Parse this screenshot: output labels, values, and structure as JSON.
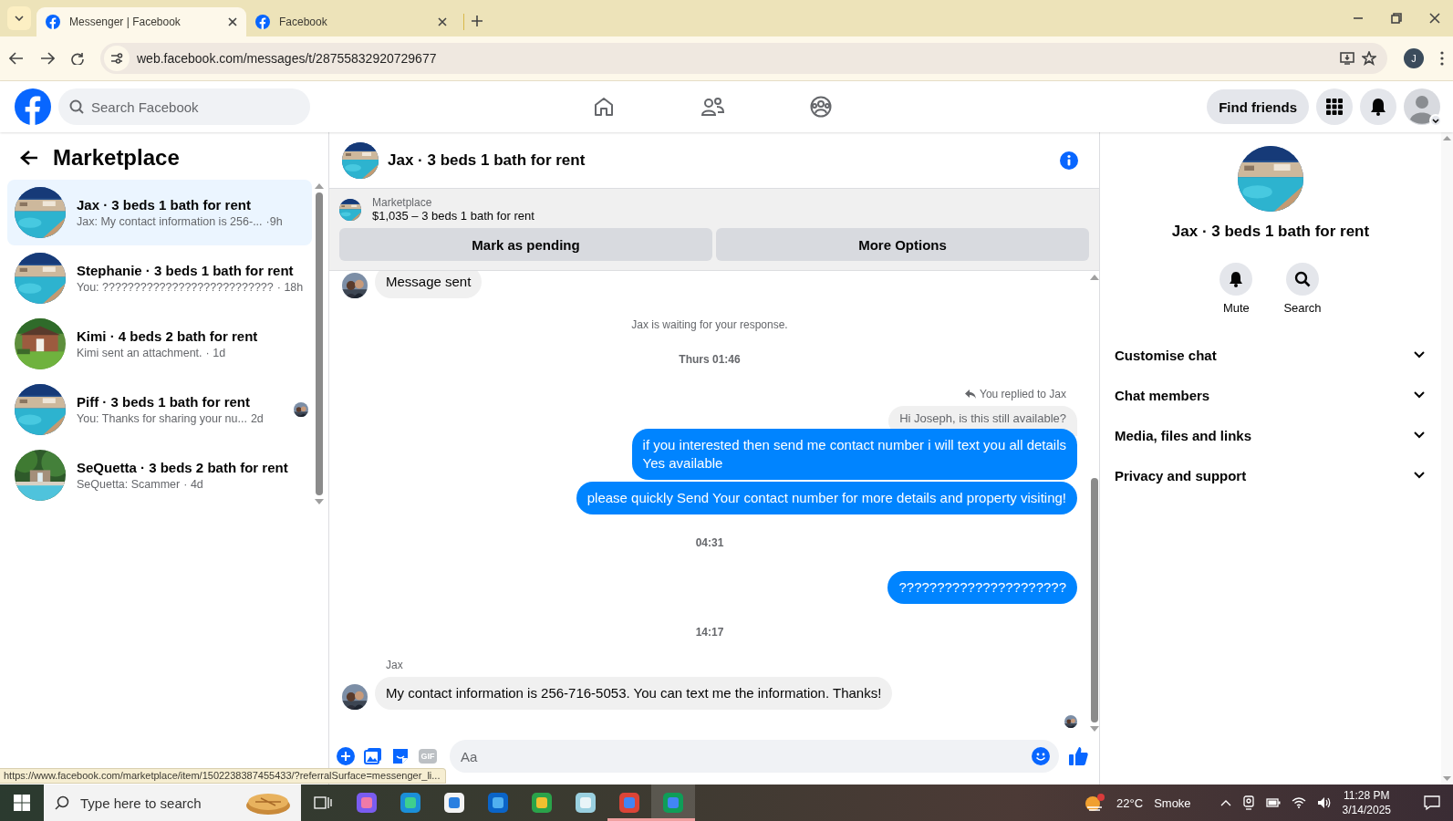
{
  "browser": {
    "tabs": [
      {
        "title": "Messenger | Facebook",
        "selected": true
      },
      {
        "title": "Facebook",
        "selected": false
      }
    ],
    "url": "web.facebook.com/messages/t/28755832920729677",
    "profile_initial": "J"
  },
  "header": {
    "search_placeholder": "Search Facebook",
    "find_friends": "Find friends"
  },
  "sidebar": {
    "title": "Marketplace",
    "conversations": [
      {
        "title": "Jax · 3 beds 1 bath for rent",
        "preview": "Jax: My contact information is 256-...",
        "time": "·9h",
        "selected": true,
        "seen": false
      },
      {
        "title": "Stephanie · 3 beds 1 bath for rent",
        "preview": "You: ???????????????????????????",
        "time": "· 18h",
        "selected": false,
        "seen": false
      },
      {
        "title": "Kimi · 4 beds 2 bath for rent",
        "preview": "Kimi sent an attachment.",
        "time": "· 1d",
        "selected": false,
        "seen": false
      },
      {
        "title": "Piff · 3 beds 1 bath for rent",
        "preview": "You: Thanks for sharing your nu...",
        "time": "2d",
        "selected": false,
        "seen": true
      },
      {
        "title": "SeQuetta · 3 beds 2 bath for rent",
        "preview": "SeQuetta: Scammer",
        "time": "· 4d",
        "selected": false,
        "seen": false
      }
    ]
  },
  "chat": {
    "title": "Jax · 3 beds 1 bath for rent",
    "listing": {
      "source": "Marketplace",
      "summary": "$1,035 – 3 beds 1 bath for rent",
      "actions": [
        "Mark as pending",
        "More Options"
      ]
    },
    "messages": [
      {
        "kind": "incoming",
        "text": "Message sent"
      },
      {
        "kind": "notice",
        "text": "Jax is waiting for your response."
      },
      {
        "kind": "timestamp",
        "text": "Thurs 01:46"
      },
      {
        "kind": "reply_note",
        "text": "You replied to Jax"
      },
      {
        "kind": "quoted",
        "text": "Hi Joseph, is this still available?"
      },
      {
        "kind": "outgoing",
        "text": "if you interested then send me contact number i will text you all details\nYes available"
      },
      {
        "kind": "outgoing",
        "text": "please quickly Send Your contact number for more details and property visiting!"
      },
      {
        "kind": "timestamp",
        "text": "04:31"
      },
      {
        "kind": "outgoing",
        "text": "??????????????????????"
      },
      {
        "kind": "timestamp",
        "text": "14:17"
      },
      {
        "kind": "sender",
        "text": "Jax"
      },
      {
        "kind": "incoming",
        "text": "My contact information is 256-716-5053. You can text me the information. Thanks!"
      },
      {
        "kind": "seen"
      }
    ],
    "composer": {
      "placeholder": "Aa",
      "gif_label": "GIF"
    }
  },
  "details": {
    "name": "Jax · 3 beds 1 bath for rent",
    "actions": [
      {
        "kind": "mute",
        "label": "Mute"
      },
      {
        "kind": "search",
        "label": "Search"
      }
    ],
    "sections": [
      {
        "label": "Customise chat",
        "expanded": false
      },
      {
        "label": "Chat members",
        "expanded": false
      },
      {
        "label": "Media, files and links",
        "expanded": false
      },
      {
        "label": "Privacy and support",
        "expanded": false
      }
    ]
  },
  "status_url": "https://www.facebook.com/marketplace/item/1502238387455433/?referralSurface=messenger_li...",
  "taskbar": {
    "search_placeholder": "Type here to search",
    "weather": {
      "temperature": "22°C",
      "condition": "Smoke"
    },
    "time": "11:28 PM",
    "date": "3/14/2025"
  }
}
